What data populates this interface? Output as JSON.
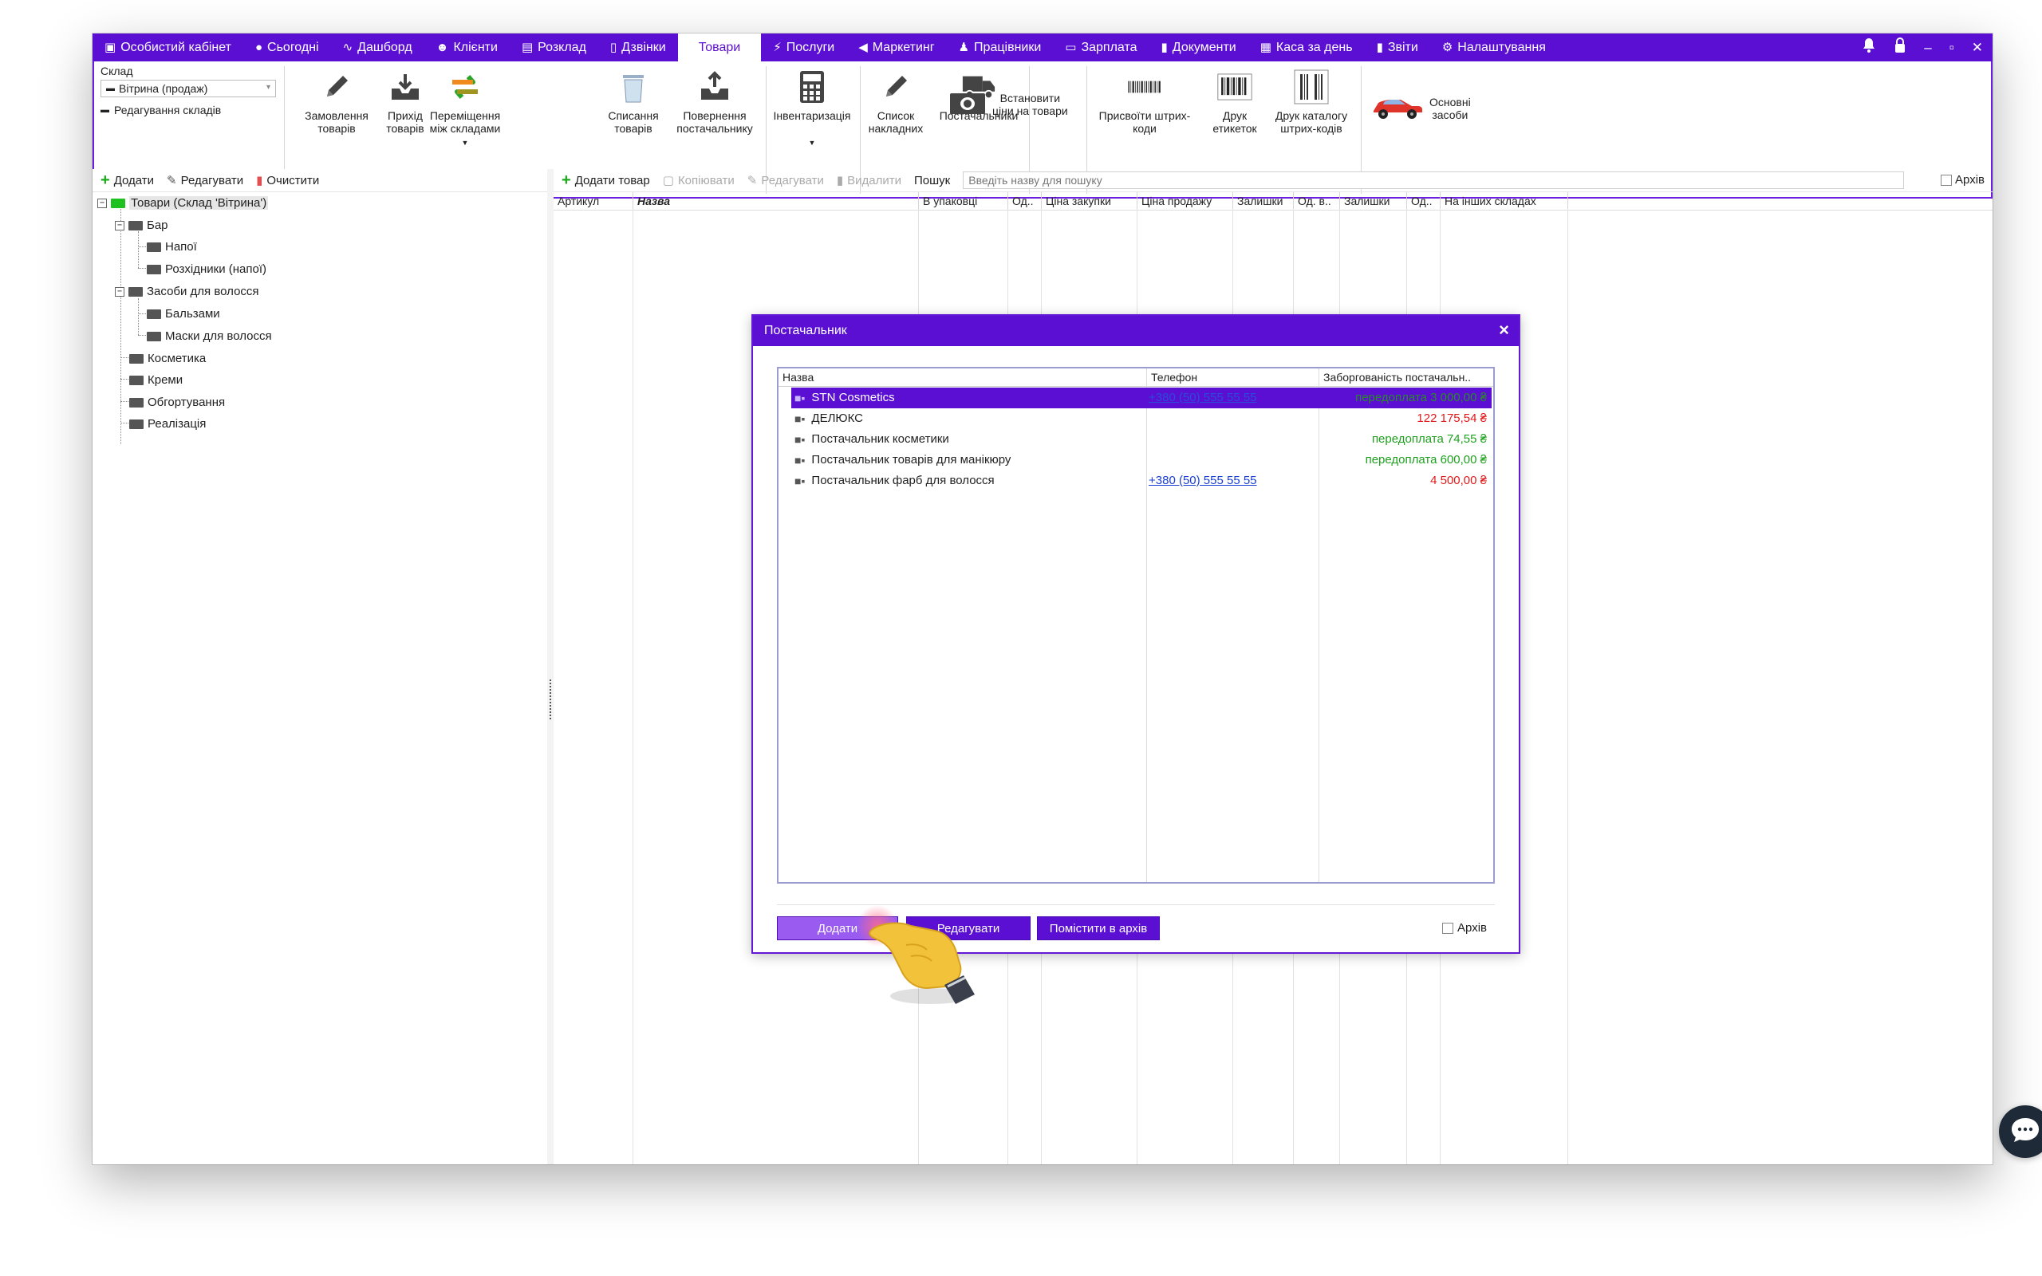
{
  "nav": {
    "items": [
      {
        "label": "Особистий кабінет",
        "icon": "briefcase-icon",
        "glyph": "▣"
      },
      {
        "label": "Сьогодні",
        "icon": "clock-icon",
        "glyph": "●"
      },
      {
        "label": "Дашборд",
        "icon": "pulse-icon",
        "glyph": "∿"
      },
      {
        "label": "Клієнти",
        "icon": "user-circle-icon",
        "glyph": "☻"
      },
      {
        "label": "Розклад",
        "icon": "calendar-icon",
        "glyph": "▤"
      },
      {
        "label": "Дзвінки",
        "icon": "phone-icon",
        "glyph": "▯"
      },
      {
        "label": "Товари",
        "icon": "",
        "glyph": ""
      },
      {
        "label": "Послуги",
        "icon": "bolt-icon",
        "glyph": "⚡"
      },
      {
        "label": "Маркетинг",
        "icon": "megaphone-icon",
        "glyph": "◀"
      },
      {
        "label": "Працівники",
        "icon": "person-icon",
        "glyph": "♟"
      },
      {
        "label": "Зарплата",
        "icon": "money-icon",
        "glyph": "▭"
      },
      {
        "label": "Документи",
        "icon": "document-icon",
        "glyph": "▮"
      },
      {
        "label": "Каса за день",
        "icon": "calculator-icon",
        "glyph": "▦"
      },
      {
        "label": "Звіти",
        "icon": "bar-chart-icon",
        "glyph": "▮"
      },
      {
        "label": "Налаштування",
        "icon": "gear-icon",
        "glyph": "⚙"
      }
    ],
    "active_index": 6,
    "bg_color": "#5b0fd3"
  },
  "ribbon": {
    "sklad_label": "Склад",
    "sklad_value": "Вітрина (продаж)",
    "sklad_edit": "Редагування складів",
    "buttons": [
      {
        "l1": "Замовлення",
        "l2": "товарів"
      },
      {
        "l1": "Прихід",
        "l2": "товарів"
      },
      {
        "l1": "Переміщення",
        "l2": "між складами"
      },
      {
        "l1": "Списання",
        "l2": "товарів"
      },
      {
        "l1": "Повернення",
        "l2": "постачальнику"
      },
      {
        "l1": "Інвентаризація",
        "l2": ""
      },
      {
        "l1": "Список",
        "l2": "накладних"
      },
      {
        "l1": "Постачальники",
        "l2": ""
      },
      {
        "l1": "Встановити",
        "l2": "ціни на товари"
      },
      {
        "l1": "Присвоїти штрих-",
        "l2": "коди"
      },
      {
        "l1": "Друк",
        "l2": "етикеток"
      },
      {
        "l1": "Друк каталогу",
        "l2": "штрих-кодів"
      },
      {
        "l1": "Основні",
        "l2": "засоби"
      }
    ]
  },
  "left": {
    "tools": {
      "add": "Додати",
      "edit": "Редагувати",
      "clear": "Очистити"
    },
    "tree": {
      "root": "Товари (Склад 'Вітрина')",
      "bar": "Бар",
      "drinks": "Напої",
      "consumables": "Розхідники (напої)",
      "hair": "Засоби для волосся",
      "balms": "Бальзами",
      "masks": "Маски для волосся",
      "cosmetics": "Косметика",
      "creams": "Креми",
      "wraps": "Обгортування",
      "realization": "Реалізація"
    }
  },
  "main": {
    "tools": {
      "add": "Додати товар",
      "copy": "Копіювати",
      "edit": "Редагувати",
      "delete": "Видалити"
    },
    "search_label": "Пошук",
    "search_placeholder": "Введіть назву для пошуку",
    "archive": "Архів",
    "columns": [
      "Артикул",
      "Назва",
      "В упаковці",
      "Од..",
      "Ціна закупки",
      "Ціна продажу",
      "Залишки",
      "Од. в..",
      "Залишки",
      "Од..",
      "На інших складах"
    ]
  },
  "dialog": {
    "title": "Постачальник",
    "headers": [
      "Назва",
      "Телефон",
      "Заборгованість постачальн.."
    ],
    "rows": [
      {
        "name": "STN Cosmetics",
        "phone": "+380 (50) 555 55 55",
        "debt": "передоплата 3 000,00 ₴",
        "debt_type": "green"
      },
      {
        "name": "ДЕЛЮКС",
        "phone": "",
        "debt": "122 175,54 ₴",
        "debt_type": "red"
      },
      {
        "name": "Постачальник косметики",
        "phone": "",
        "debt": "передоплата 74,55 ₴",
        "debt_type": "green"
      },
      {
        "name": "Постачальник товарів для манікюру",
        "phone": "",
        "debt": "передоплата 600,00 ₴",
        "debt_type": "green"
      },
      {
        "name": "Постачальник фарб для волосся",
        "phone": "+380 (50) 555 55 55",
        "debt": "4 500,00 ₴",
        "debt_type": "red"
      }
    ],
    "selected_index": 0,
    "buttons": {
      "add": "Додати",
      "edit": "Редагувати",
      "archive": "Помістити в архів"
    },
    "archive_check": "Архів"
  }
}
